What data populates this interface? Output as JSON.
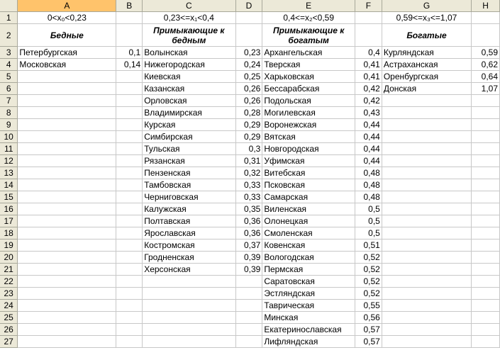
{
  "columns": [
    "A",
    "B",
    "C",
    "D",
    "E",
    "F",
    "G",
    "H"
  ],
  "row1": {
    "a": "0<x₀<0,23",
    "c": "0,23<=x₁<0,4",
    "e": "0,4<=x₂<0,59",
    "g": "0,59<=x₃<=1,07"
  },
  "row2": {
    "a": "Бедные",
    "c": "Примыкающие к бедным",
    "e": "Примыкающие к богатым",
    "g": "Богатые"
  },
  "rows": [
    {
      "n": "3",
      "a": "Петербургская",
      "b": "0,1",
      "c": "Волынская",
      "d": "0,23",
      "e": "Архангельская",
      "f": "0,4",
      "g": "Курляндская",
      "h": "0,59"
    },
    {
      "n": "4",
      "a": "Московская",
      "b": "0,14",
      "c": "Нижегородская",
      "d": "0,24",
      "e": "Тверская",
      "f": "0,41",
      "g": "Астраханская",
      "h": "0,62"
    },
    {
      "n": "5",
      "a": "",
      "b": "",
      "c": "Киевская",
      "d": "0,25",
      "e": "Харьковская",
      "f": "0,41",
      "g": "Оренбургская",
      "h": "0,64"
    },
    {
      "n": "6",
      "a": "",
      "b": "",
      "c": "Казанская",
      "d": "0,26",
      "e": "Бессарабская",
      "f": "0,42",
      "g": "Донская",
      "h": "1,07"
    },
    {
      "n": "7",
      "a": "",
      "b": "",
      "c": "Орловская",
      "d": "0,26",
      "e": "Подольская",
      "f": "0,42",
      "g": "",
      "h": ""
    },
    {
      "n": "8",
      "a": "",
      "b": "",
      "c": "Владимирская",
      "d": "0,28",
      "e": "Могилевская",
      "f": "0,43",
      "g": "",
      "h": ""
    },
    {
      "n": "9",
      "a": "",
      "b": "",
      "c": "Курская",
      "d": "0,29",
      "e": "Воронежская",
      "f": "0,44",
      "g": "",
      "h": ""
    },
    {
      "n": "10",
      "a": "",
      "b": "",
      "c": "Симбирская",
      "d": "0,29",
      "e": "Вятская",
      "f": "0,44",
      "g": "",
      "h": ""
    },
    {
      "n": "11",
      "a": "",
      "b": "",
      "c": "Тульская",
      "d": "0,3",
      "e": "Новгородская",
      "f": "0,44",
      "g": "",
      "h": ""
    },
    {
      "n": "12",
      "a": "",
      "b": "",
      "c": "Рязанская",
      "d": "0,31",
      "e": "Уфимская",
      "f": "0,44",
      "g": "",
      "h": ""
    },
    {
      "n": "13",
      "a": "",
      "b": "",
      "c": "Пензенская",
      "d": "0,32",
      "e": "Витебская",
      "f": "0,48",
      "g": "",
      "h": ""
    },
    {
      "n": "14",
      "a": "",
      "b": "",
      "c": "Тамбовская",
      "d": "0,33",
      "e": "Псковская",
      "f": "0,48",
      "g": "",
      "h": ""
    },
    {
      "n": "15",
      "a": "",
      "b": "",
      "c": "Черниговская",
      "d": "0,33",
      "e": "Самарская",
      "f": "0,48",
      "g": "",
      "h": ""
    },
    {
      "n": "16",
      "a": "",
      "b": "",
      "c": "Калужская",
      "d": "0,35",
      "e": "Виленская",
      "f": "0,5",
      "g": "",
      "h": ""
    },
    {
      "n": "17",
      "a": "",
      "b": "",
      "c": "Полтавская",
      "d": "0,36",
      "e": "Олонецкая",
      "f": "0,5",
      "g": "",
      "h": ""
    },
    {
      "n": "18",
      "a": "",
      "b": "",
      "c": "Ярославская",
      "d": "0,36",
      "e": "Смоленская",
      "f": "0,5",
      "g": "",
      "h": ""
    },
    {
      "n": "19",
      "a": "",
      "b": "",
      "c": "Костромская",
      "d": "0,37",
      "e": "Ковенская",
      "f": "0,51",
      "g": "",
      "h": ""
    },
    {
      "n": "20",
      "a": "",
      "b": "",
      "c": "Гродненская",
      "d": "0,39",
      "e": "Вологодская",
      "f": "0,52",
      "g": "",
      "h": ""
    },
    {
      "n": "21",
      "a": "",
      "b": "",
      "c": "Херсонская",
      "d": "0,39",
      "e": "Пермская",
      "f": "0,52",
      "g": "",
      "h": ""
    },
    {
      "n": "22",
      "a": "",
      "b": "",
      "c": "",
      "d": "",
      "e": "Саратовская",
      "f": "0,52",
      "g": "",
      "h": ""
    },
    {
      "n": "23",
      "a": "",
      "b": "",
      "c": "",
      "d": "",
      "e": "Эстляндская",
      "f": "0,52",
      "g": "",
      "h": ""
    },
    {
      "n": "24",
      "a": "",
      "b": "",
      "c": "",
      "d": "",
      "e": "Таврическая",
      "f": "0,55",
      "g": "",
      "h": ""
    },
    {
      "n": "25",
      "a": "",
      "b": "",
      "c": "",
      "d": "",
      "e": "Минская",
      "f": "0,56",
      "g": "",
      "h": ""
    },
    {
      "n": "26",
      "a": "",
      "b": "",
      "c": "",
      "d": "",
      "e": "Екатеринославская",
      "f": "0,57",
      "g": "",
      "h": ""
    },
    {
      "n": "27",
      "a": "",
      "b": "",
      "c": "",
      "d": "",
      "e": "Лифляндская",
      "f": "0,57",
      "g": "",
      "h": ""
    }
  ]
}
